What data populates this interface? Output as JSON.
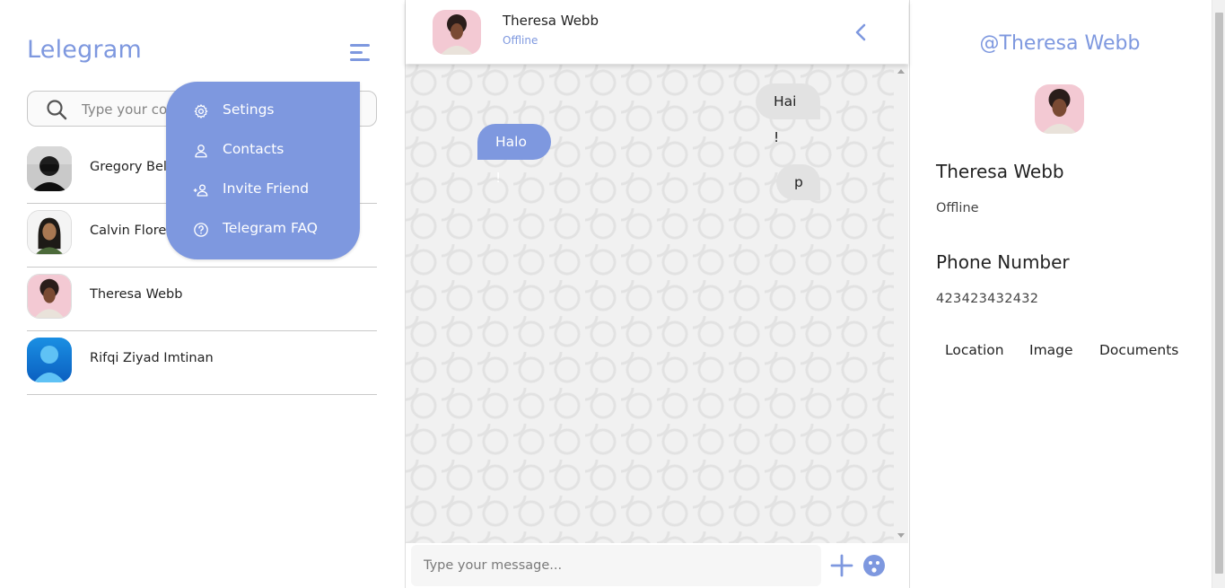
{
  "app": {
    "brand": "Lelegram"
  },
  "search": {
    "placeholder": "Type your contact..."
  },
  "contacts": [
    {
      "name": "Gregory Bell"
    },
    {
      "name": "Calvin Flores"
    },
    {
      "name": "Theresa Webb"
    },
    {
      "name": "Rifqi Ziyad Imtinan"
    }
  ],
  "menu": {
    "items": [
      {
        "label": "Setings",
        "icon": "gear-icon"
      },
      {
        "label": "Contacts",
        "icon": "user-icon"
      },
      {
        "label": "Invite Friend",
        "icon": "add-user-icon"
      },
      {
        "label": "Telegram FAQ",
        "icon": "help-icon"
      }
    ]
  },
  "chat": {
    "name": "Theresa Webb",
    "status": "Offline",
    "messages": [
      {
        "text": "Hai !",
        "direction": "out"
      },
      {
        "text": "Halo !",
        "direction": "in"
      },
      {
        "text": "p",
        "direction": "out"
      }
    ],
    "input_placeholder": "Type your message..."
  },
  "profile": {
    "handle": "@Theresa Webb",
    "name": "Theresa Webb",
    "status": "Offline",
    "phone_label": "Phone Number",
    "phone": "423423432432",
    "tabs": [
      "Location",
      "Image",
      "Documents"
    ]
  },
  "colors": {
    "accent": "#7e98df",
    "bubble_out": "#e2e2e2",
    "text": "#232323"
  }
}
